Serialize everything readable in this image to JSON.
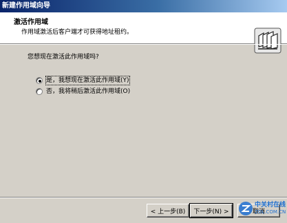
{
  "window": {
    "title": "新建作用域向导"
  },
  "header": {
    "title": "激活作用域",
    "subtitle": "作用域激活后客户端才可获得地址租约。",
    "icon": "folders-wizard-icon"
  },
  "body": {
    "question": "您想现在激活此作用域吗?",
    "options": [
      {
        "label": "是，我想现在激活此作用域(Y)",
        "selected": true
      },
      {
        "label": "否，我将稍后激活此作用域(O)",
        "selected": false
      }
    ]
  },
  "buttons": {
    "back": "< 上一步(B)",
    "next": "下一步(N) >",
    "cancel": "取消"
  },
  "watermark": {
    "text": "中关村在线",
    "sub": "ZOL.COM.CN"
  }
}
